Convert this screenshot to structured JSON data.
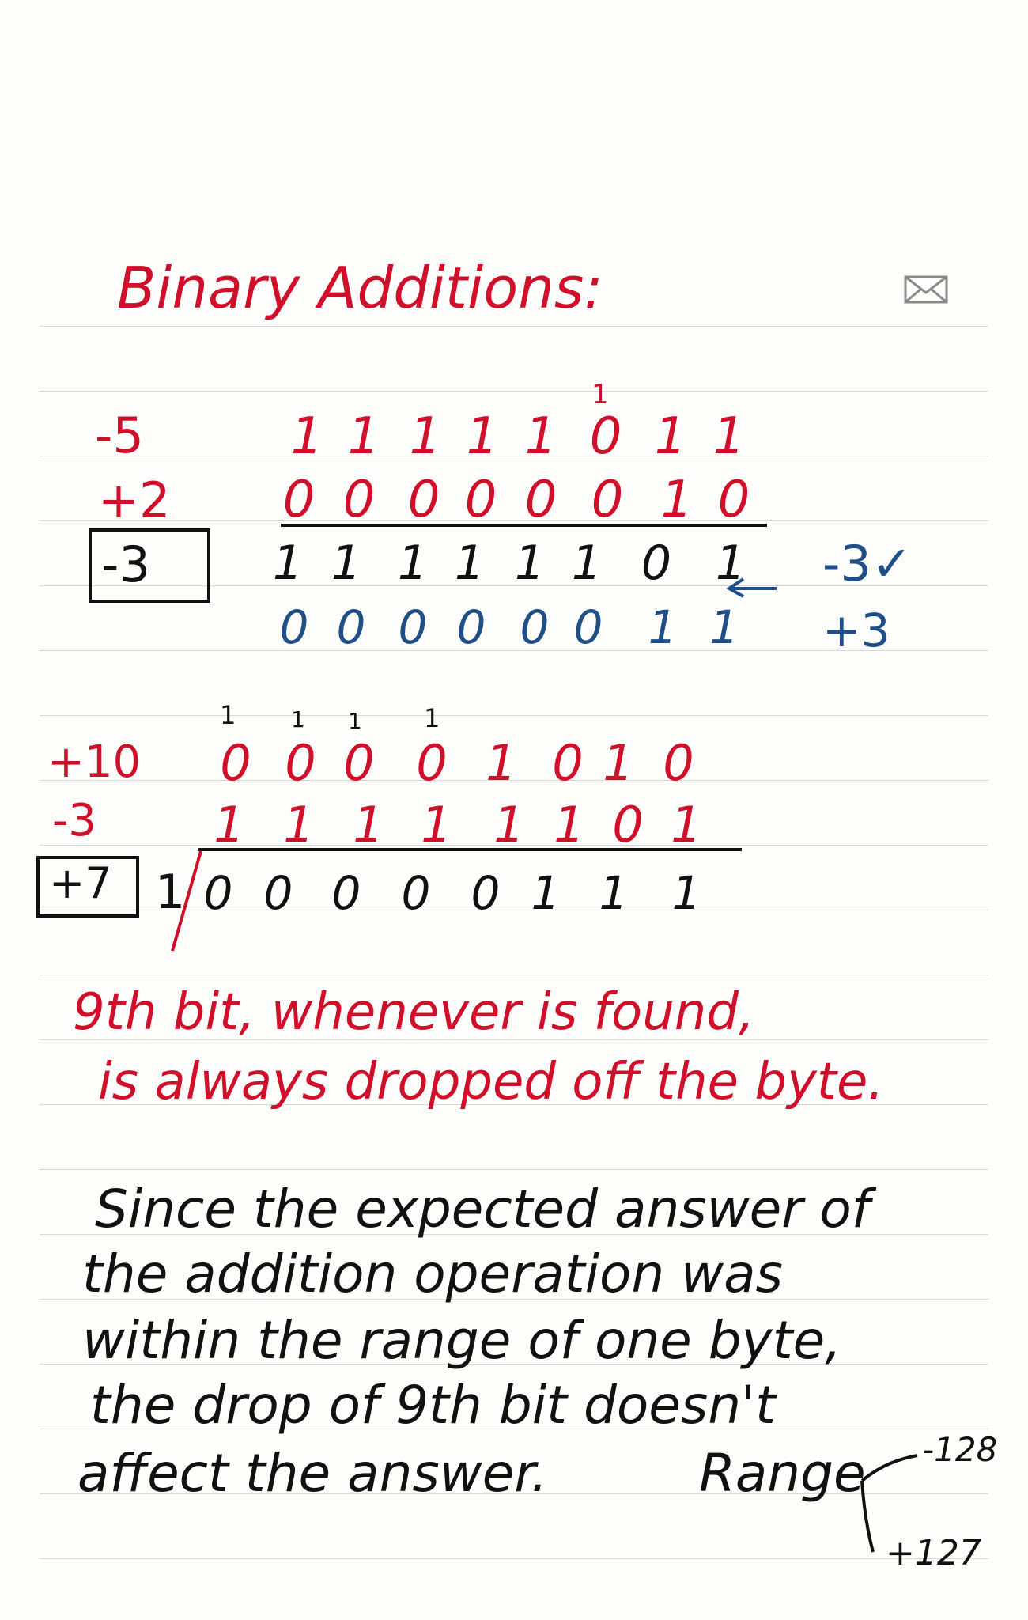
{
  "title": "Binary Additions:",
  "icons": {
    "mail": "envelope-icon"
  },
  "colors": {
    "red": "#d0102a",
    "blue": "#1f4f86",
    "black": "#111111",
    "rule": "#d8d8d8"
  },
  "example1": {
    "operand_a": {
      "label": "-5",
      "bits": [
        "1",
        "1",
        "1",
        "1",
        "1",
        "0",
        "1",
        "1"
      ]
    },
    "operand_b": {
      "label": "+2",
      "bits": [
        "0",
        "0",
        "0",
        "0",
        "0",
        "0",
        "1",
        "0"
      ]
    },
    "result": {
      "label": "-3",
      "bits": [
        "1",
        "1",
        "1",
        "1",
        "1",
        "1",
        "0",
        "1"
      ],
      "check": "-3✓"
    },
    "complement": {
      "bits": [
        "0",
        "0",
        "0",
        "0",
        "0",
        "0",
        "1",
        "1"
      ],
      "label": "+3"
    },
    "carry_mark": "1"
  },
  "example2": {
    "operand_a": {
      "label": "+10",
      "bits": [
        "0",
        "0",
        "0",
        "0",
        "1",
        "0",
        "1",
        "0"
      ]
    },
    "operand_b": {
      "label": "-3",
      "bits": [
        "1",
        "1",
        "1",
        "1",
        "1",
        "1",
        "0",
        "1"
      ]
    },
    "result": {
      "label": "+7",
      "overflow_bit": "1",
      "bits": [
        "0",
        "0",
        "0",
        "0",
        "0",
        "1",
        "1",
        "1"
      ]
    },
    "carry_marks": [
      "1",
      "1",
      "1",
      "1"
    ]
  },
  "note": {
    "line1": "9th bit, whenever is found,",
    "line2": "is always dropped off the byte."
  },
  "paragraph": {
    "line1": "Since the expected answer of",
    "line2": "the addition operation was",
    "line3": "within the range of one byte,",
    "line4": "the drop of 9th bit doesn't",
    "line5": "affect the answer.",
    "range_label": "Range",
    "range_min": "-128",
    "range_max": "+127"
  }
}
